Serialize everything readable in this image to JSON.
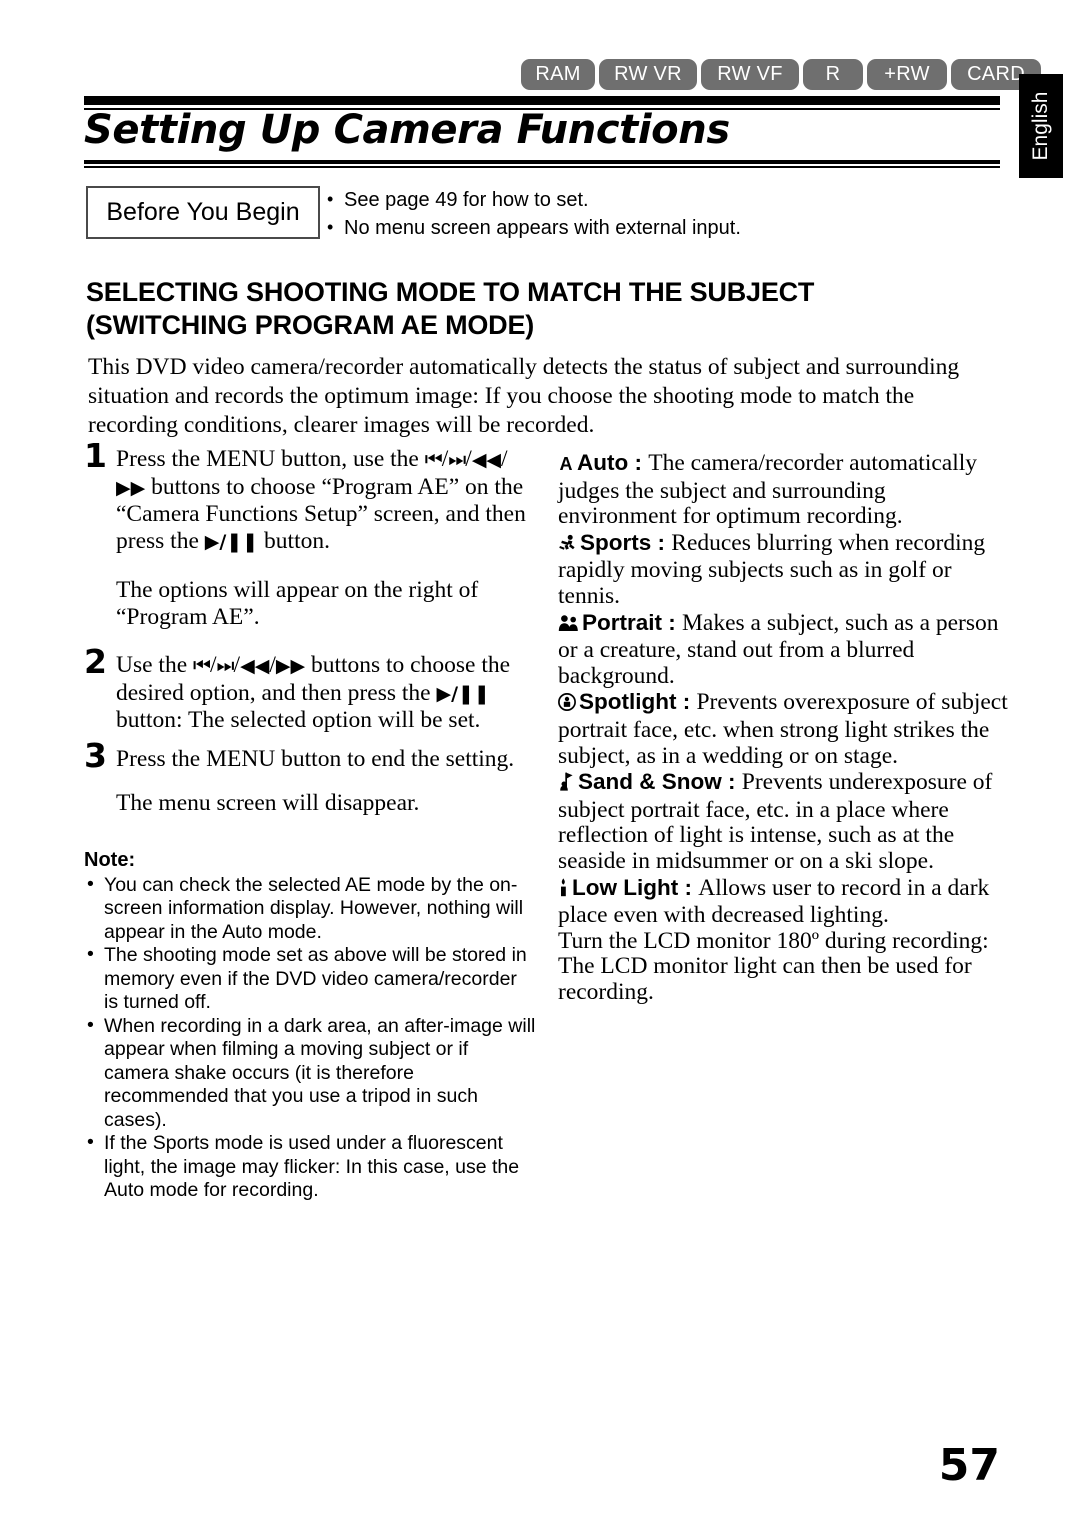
{
  "header": {
    "badges": [
      "RAM",
      "RW VR",
      "RW VF",
      "R",
      "+RW",
      "CARD"
    ],
    "language_tab": "English",
    "title": "Setting Up Camera Functions"
  },
  "before_you_begin": {
    "label": "Before You Begin",
    "items": [
      "See page 49 for how to set.",
      "No menu screen appears with external input."
    ]
  },
  "section": {
    "heading_line1": "SELECTING SHOOTING MODE TO MATCH THE SUBJECT",
    "heading_line2": "(SWITCHING PROGRAM AE MODE)",
    "intro": "This DVD video camera/recorder automatically detects the status of subject and surrounding situation and records the optimum image: If you choose the shooting mode to match the recording conditions, clearer images will be recorded."
  },
  "steps": [
    {
      "number": "1",
      "text_a": "Press the MENU button, use the ",
      "glyph_1": "⏮",
      "sep_1": "/",
      "glyph_2": "⏭",
      "sep_2": "/",
      "glyph_3": "◀◀",
      "sep_3": "/",
      "glyph_4": "▶▶",
      "text_b": " buttons to choose “Program AE” on the “Camera Functions Setup” screen, and then press the ",
      "glyph_play": "▶/❚❚",
      "text_c": " button.",
      "sub": "The options will appear on the right of “Program AE”."
    },
    {
      "number": "2",
      "text_a": "Use the ",
      "glyph_1": "⏮",
      "sep_1": "/",
      "glyph_2": "⏭",
      "sep_2": "/",
      "glyph_3": "◀◀",
      "sep_3": "/",
      "glyph_4": "▶▶",
      "text_b": " buttons to choose the desired option, and then press the ",
      "glyph_play": "▶/❚❚",
      "text_c": " button: The selected option will be set.",
      "sub": ""
    },
    {
      "number": "3",
      "text_a": "Press the MENU button to end the setting.",
      "sub": "The menu screen will disappear."
    }
  ],
  "note": {
    "title": "Note:",
    "items": [
      "You can check the selected AE mode by the on-screen information display. However, nothing will appear in the Auto mode.",
      "The shooting mode set as above will be stored in memory even if the DVD video camera/recorder is turned off.",
      "When recording in a dark area, an after-image will appear when filming a moving subject or if camera shake occurs (it is therefore recommended that you use a tripod in such cases).",
      "If the Sports mode is used under a fluorescent light, the image may flicker: In this case, use the Auto mode for recording."
    ]
  },
  "ae_modes": [
    {
      "icon": "letter-a-icon",
      "name": "Auto",
      "colon": " : ",
      "description": "The camera/recorder automatically judges the subject and surrounding environment for optimum recording."
    },
    {
      "icon": "running-person-icon",
      "name": "Sports",
      "colon": " : ",
      "description": "Reduces blurring when recording rapidly moving subjects such as in golf or tennis."
    },
    {
      "icon": "two-people-icon",
      "name": "Portrait",
      "colon": " : ",
      "description": "Makes a subject, such as a person or a creature, stand out from a blurred background."
    },
    {
      "icon": "spotlight-person-circle-icon",
      "name": "Spotlight",
      "colon": " : ",
      "description": "Prevents overexposure of subject portrait face, etc. when strong light strikes the subject, as in a wedding or on stage."
    },
    {
      "icon": "person-with-flag-icon",
      "name": "Sand & Snow",
      "colon": " : ",
      "description": "Prevents underexposure of subject portrait face, etc. in a place where reflection of light is intense, such as at the seaside in midsummer or on a ski slope."
    },
    {
      "icon": "candle-low-light-icon",
      "name": "Low Light",
      "colon": " : ",
      "description": "Allows user to record in a dark place even with decreased lighting."
    }
  ],
  "closing_paragraph": "Turn the LCD monitor 180º during recording: The LCD monitor light can then be used for recording.",
  "page_number": "57",
  "colors": {
    "badge_background": "#6f6f6f",
    "badge_text": "#ffffff",
    "tab_background": "#000000",
    "text": "#000000"
  }
}
